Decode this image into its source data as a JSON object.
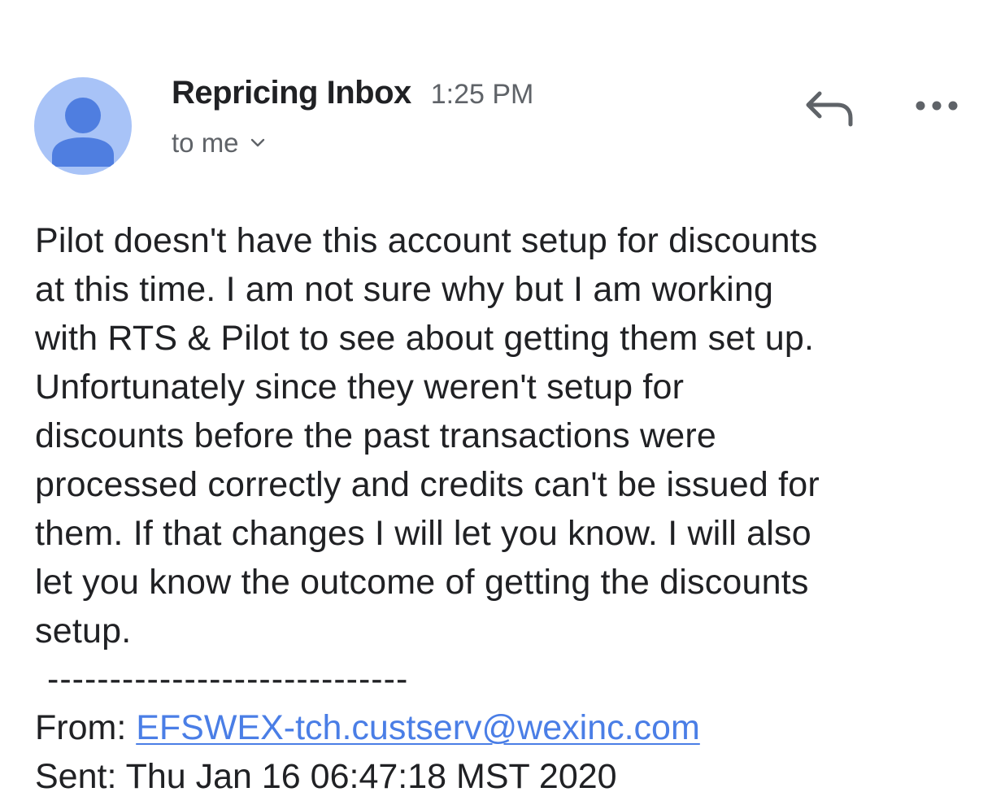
{
  "header": {
    "sender_name": "Repricing Inbox",
    "time": "1:25 PM",
    "recipient_label": "to me",
    "avatar_icon": "person-icon",
    "reply_icon": "reply-icon",
    "more_icon": "more-horizontal-icon"
  },
  "message": {
    "body": "Pilot doesn't have this account setup for discounts\nat this time. I am not sure why but I am working\nwith RTS & Pilot to see about getting them set up.\nUnfortunately since they weren't setup for\ndiscounts before the past transactions were\nprocessed correctly and credits can't be issued for\nthem. If that changes I will let you know. I will also\nlet you know the outcome of getting the discounts\nsetup.",
    "separator": "-----------------------------",
    "from_label": "From: ",
    "from_email": "EFSWEX-tch.custserv@wexinc.com",
    "sent_label": "Sent: ",
    "sent_value": "Thu Jan 16 06:47:18 MST 2020"
  },
  "colors": {
    "avatar_bg": "#a8c3f7",
    "avatar_fg": "#4f7ee0",
    "link": "#4a7ee6",
    "secondary_text": "#5f6368"
  }
}
